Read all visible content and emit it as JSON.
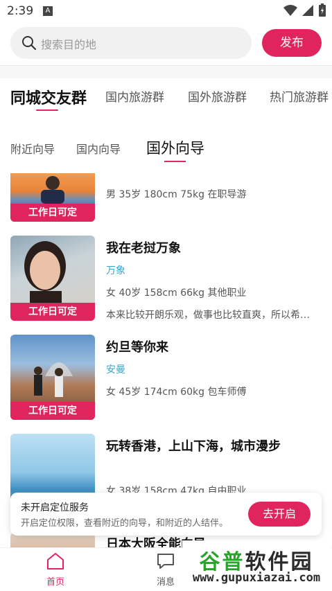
{
  "status": {
    "time": "2:39",
    "indicator": "A"
  },
  "search": {
    "placeholder": "搜索目的地",
    "publish_label": "发布"
  },
  "main_tabs": [
    {
      "label": "同城交友群",
      "active": true
    },
    {
      "label": "国内旅游群"
    },
    {
      "label": "国外旅游群"
    },
    {
      "label": "热门旅游群"
    }
  ],
  "sub_tabs": [
    {
      "label": "附近向导"
    },
    {
      "label": "国内向导"
    },
    {
      "label": "国外向导",
      "active": true
    }
  ],
  "guides": [
    {
      "title": "",
      "city": "",
      "meta": "男 35岁  180cm  75kg 在职导游",
      "desc": "",
      "badge": "工作日可定"
    },
    {
      "title": "我在老挝万象",
      "city": "万象",
      "meta": "女 40岁  158cm  66kg 其他职业",
      "desc": "本来比较开朗乐观，做事也比较直爽，所以希…",
      "badge": "工作日可定"
    },
    {
      "title": "约旦等你来",
      "city": "安曼",
      "meta": "女 45岁  174cm  60kg 包车师傅",
      "desc": "",
      "badge": "工作日可定"
    },
    {
      "title": "玩转香港，上山下海，城市漫步",
      "city": "",
      "meta": "女 38岁  158cm  47kg 自由职业",
      "desc": "",
      "badge": ""
    },
    {
      "title": "日本大阪全能向导",
      "city": "",
      "meta": "",
      "desc": "",
      "badge": ""
    }
  ],
  "toast": {
    "title": "未开启定位服务",
    "subtitle": "开启定位权限，查看附近的向导，和附近的人结伴。",
    "button": "去开启"
  },
  "nav": {
    "home": "首页",
    "messages": "消息"
  },
  "watermark": {
    "line1a": "谷普",
    "line1b": "软件园",
    "line2": "www.gupuxiazai.com"
  },
  "colors": {
    "accent": "#e0245e",
    "city": "#3aa7c9"
  }
}
